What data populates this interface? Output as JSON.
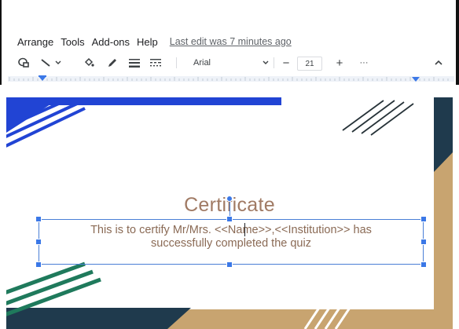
{
  "menu": {
    "items": [
      "Arrange",
      "Tools",
      "Add-ons",
      "Help"
    ],
    "last_edit": "Last edit was 7 minutes ago"
  },
  "toolbar": {
    "icons": [
      "shape-icon",
      "line-icon",
      "fill-color-icon",
      "border-color-icon",
      "border-weight-icon",
      "border-dash-icon"
    ],
    "font": "Arial",
    "font_size": "21",
    "minus": "−",
    "plus": "+",
    "more": "···",
    "collapse": "^"
  },
  "slide": {
    "title": "Certificate",
    "body_line1": "This is to certify Mr/Mrs. <<Name>>,<<Institution>> has",
    "body_line2": "successfully completed the quiz",
    "colors": {
      "blue": "#2144d4",
      "navy": "#1f3a4d",
      "green": "#1f7a5c",
      "gold": "#c8a470",
      "title": "#a07a64",
      "body": "#8a6a55",
      "selection": "#4a7fd6"
    }
  }
}
